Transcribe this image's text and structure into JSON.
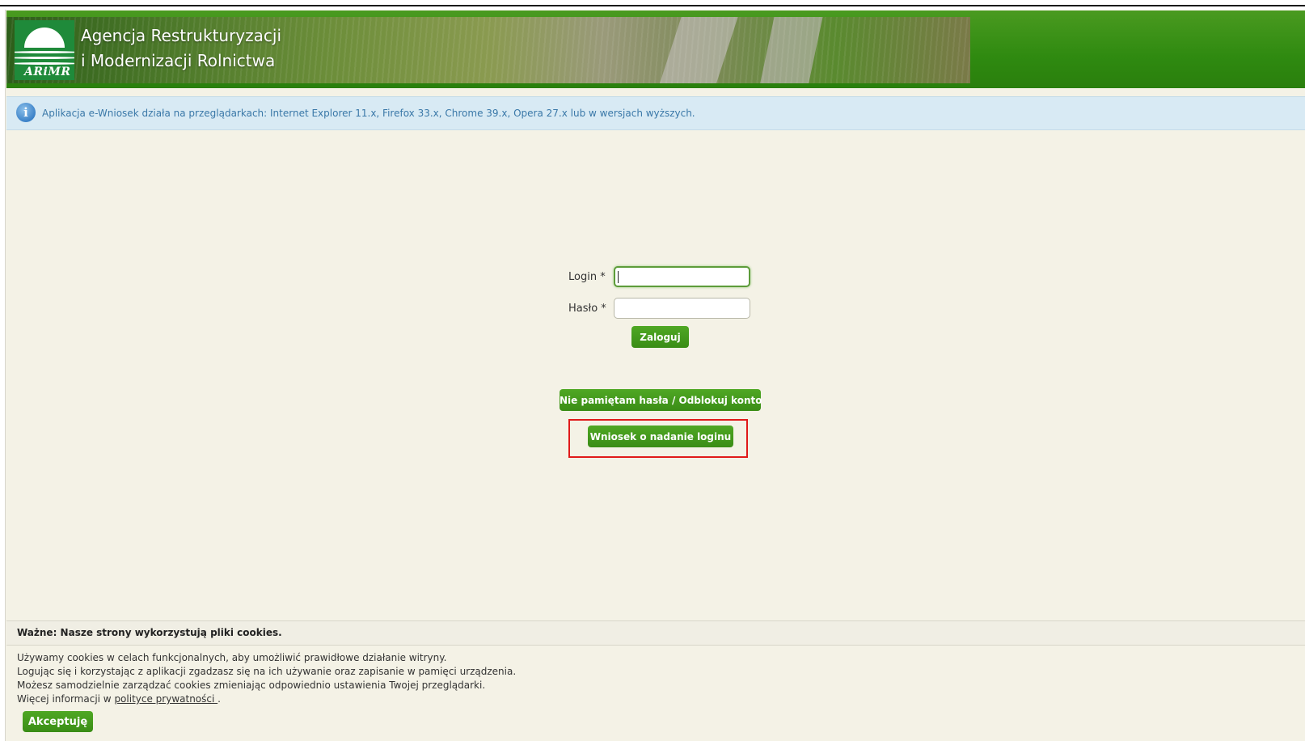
{
  "header": {
    "logo_text": "ARiMR",
    "org_line1": "Agencja Restrukturyzacji",
    "org_line2": "i Modernizacji Rolnictwa"
  },
  "info": {
    "icon": "info-icon",
    "message": "Aplikacja e-Wniosek działa na przeglądarkach: Internet Explorer 11.x, Firefox 33.x, Chrome 39.x, Opera 27.x lub w wersjach wyższych."
  },
  "login_form": {
    "login_label": "Login *",
    "login_value": "",
    "password_label": "Hasło *",
    "password_value": "",
    "submit_label": "Zaloguj"
  },
  "account_links": {
    "forgot_label": "Nie pamiętam hasła / Odblokuj konto",
    "request_login_label": "Wniosek o nadanie loginu"
  },
  "cookies": {
    "title": "Ważne: Nasze strony wykorzystują pliki cookies.",
    "line1": "Używamy cookies w celach funkcjonalnych, aby umożliwić prawidłowe działanie witryny.",
    "line2": "Logując się i korzystając z aplikacji zgadzasz się na ich używanie oraz zapisanie w pamięci urządzenia.",
    "line3": "Możesz samodzielnie zarządzać cookies zmieniając odpowiednio ustawienia Twojej przeglądarki.",
    "line4_prefix": "Więcej informacji w ",
    "privacy_link": "polityce prywatności ",
    "line4_suffix": ".",
    "accept_label": "Akceptuję"
  },
  "colors": {
    "accent_green": "#3a8d16",
    "highlight_red": "#e01a1a",
    "info_background": "#d8eaf4",
    "page_background": "#f4f2e6"
  }
}
